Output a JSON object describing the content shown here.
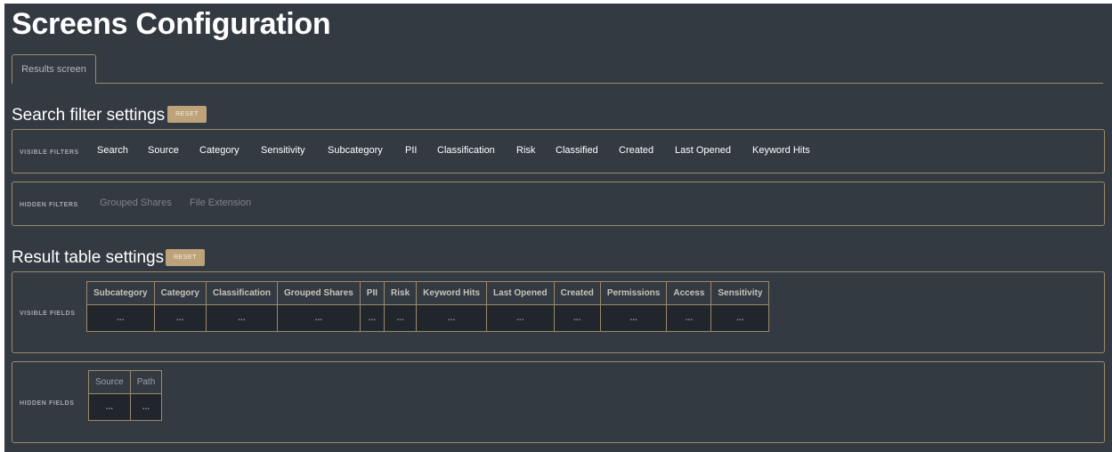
{
  "page": {
    "title": "Screens Configuration"
  },
  "tabs": [
    {
      "label": "Results screen",
      "active": true
    }
  ],
  "search_filter_settings": {
    "title": "Search filter settings",
    "reset_label": "RESET",
    "visible_label": "VISIBLE FILTERS",
    "visible_filters": [
      "Search",
      "Source",
      "Category",
      "Sensitivity",
      "Subcategory",
      "PII",
      "Classification",
      "Risk",
      "Classified",
      "Created",
      "Last Opened",
      "Keyword Hits"
    ],
    "hidden_label": "HIDDEN FILTERS",
    "hidden_filters": [
      "Grouped Shares",
      "File Extension"
    ]
  },
  "result_table_settings": {
    "title": "Result table settings",
    "reset_label": "RESET",
    "visible_label": "VISIBLE FIELDS",
    "visible_fields": [
      "Subcategory",
      "Category",
      "Classification",
      "Grouped Shares",
      "PII",
      "Risk",
      "Keyword Hits",
      "Last Opened",
      "Created",
      "Permissions",
      "Access",
      "Sensitivity"
    ],
    "hidden_label": "HIDDEN FIELDS",
    "hidden_fields": [
      "Source",
      "Path"
    ],
    "cell_placeholder": "..."
  },
  "colors": {
    "background": "#343a42",
    "accent": "#bea37a",
    "border": "#9a8a6d"
  }
}
